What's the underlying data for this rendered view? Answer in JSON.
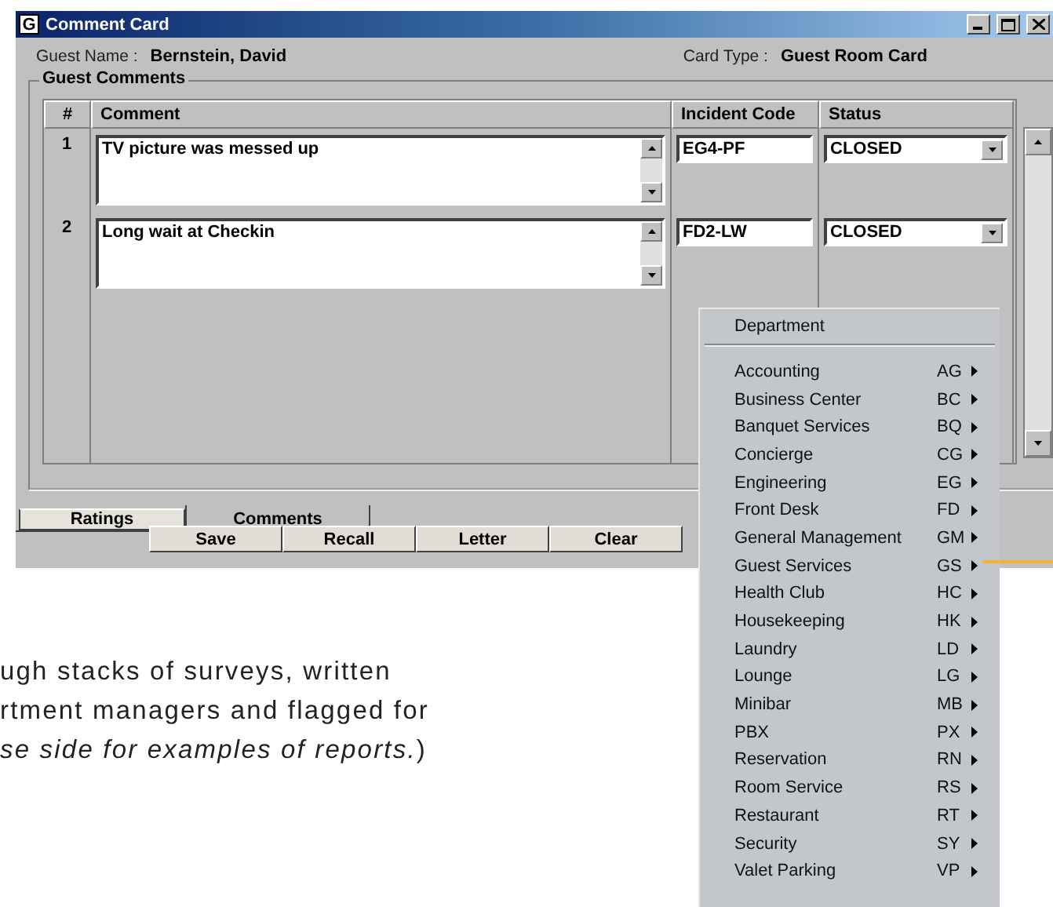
{
  "window": {
    "app_icon_letter": "G",
    "title": "Comment Card",
    "guest_name_label": "Guest Name :",
    "guest_name": "Bernstein, David",
    "card_type_label": "Card Type :",
    "card_type": "Guest Room Card"
  },
  "guest_comments": {
    "title": "Guest Comments",
    "columns": [
      "#",
      "Comment",
      "Incident Code",
      "Status"
    ],
    "rows": [
      {
        "number": "1",
        "comment": "TV picture was messed up",
        "incident_code": "EG4-PF",
        "status": "CLOSED"
      },
      {
        "number": "2",
        "comment": "Long wait at Checkin",
        "incident_code": "FD2-LW",
        "status": "CLOSED"
      }
    ]
  },
  "tabs": [
    {
      "label": "Ratings",
      "selected": false
    },
    {
      "label": "Comments",
      "selected": true
    }
  ],
  "buttons": [
    "Save",
    "Recall",
    "Letter",
    "Clear"
  ],
  "department_menu": {
    "title": "Department",
    "items": [
      {
        "label": "Accounting",
        "code": "AG"
      },
      {
        "label": "Business Center",
        "code": "BC"
      },
      {
        "label": "Banquet Services",
        "code": "BQ"
      },
      {
        "label": "Concierge",
        "code": "CG"
      },
      {
        "label": "Engineering",
        "code": "EG"
      },
      {
        "label": "Front Desk",
        "code": "FD"
      },
      {
        "label": "General Management",
        "code": "GM"
      },
      {
        "label": "Guest Services",
        "code": "GS"
      },
      {
        "label": "Health Club",
        "code": "HC"
      },
      {
        "label": "Housekeeping",
        "code": "HK"
      },
      {
        "label": "Laundry",
        "code": "LD"
      },
      {
        "label": "Lounge",
        "code": "LG"
      },
      {
        "label": "Minibar",
        "code": "MB"
      },
      {
        "label": "PBX",
        "code": "PX"
      },
      {
        "label": "Reservation",
        "code": "RN"
      },
      {
        "label": "Room Service",
        "code": "RS"
      },
      {
        "label": "Restaurant",
        "code": "RT"
      },
      {
        "label": "Security",
        "code": "SY"
      },
      {
        "label": "Valet Parking",
        "code": "VP"
      }
    ]
  },
  "page_text": [
    "ugh stacks of surveys, written",
    "rtment managers and flagged for",
    "*se side for examples of reports.*)"
  ]
}
